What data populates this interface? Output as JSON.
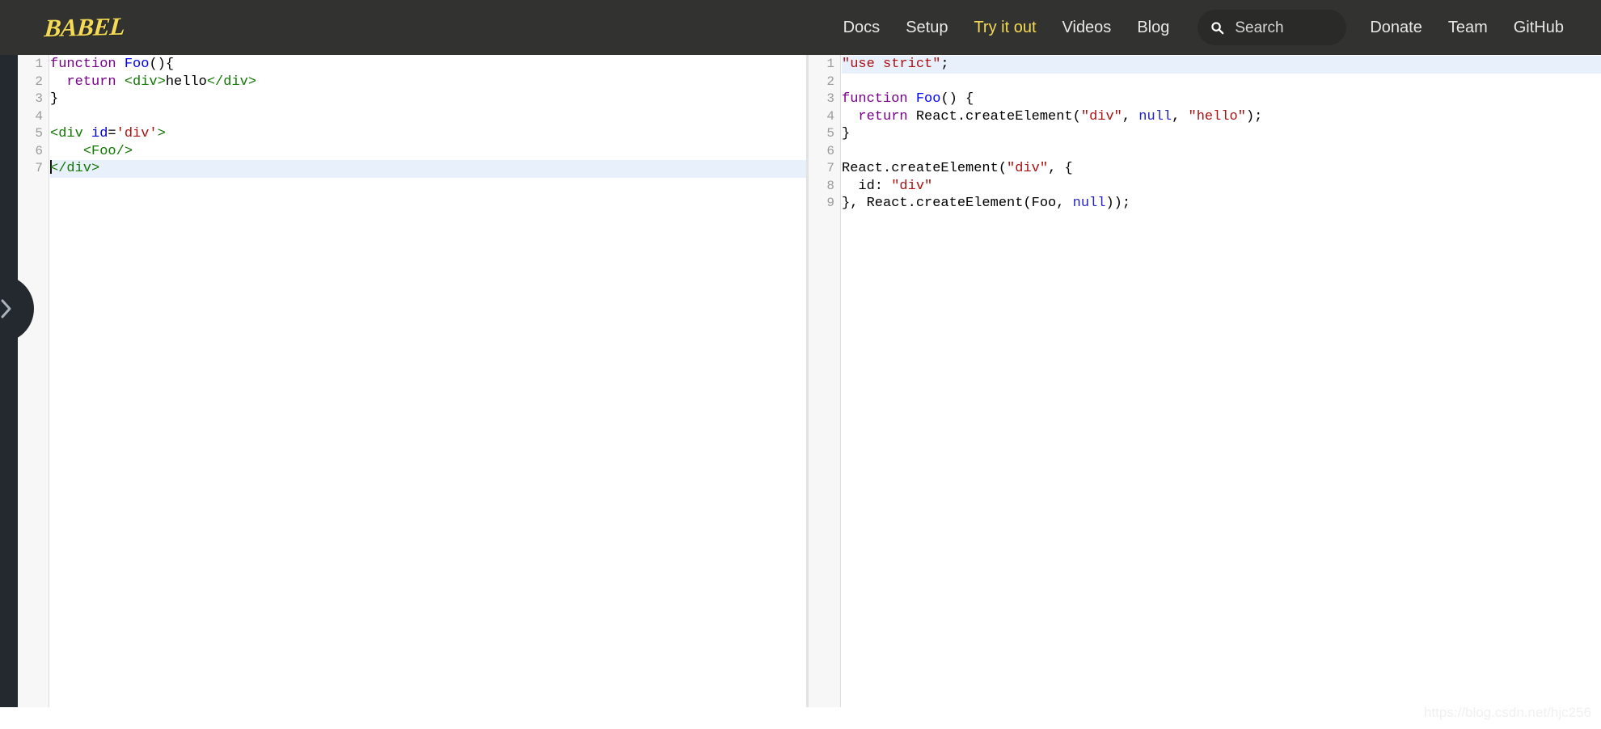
{
  "header": {
    "logo_text": "BABEL",
    "logo_color": "#f5da55",
    "background": "#323330",
    "nav_items": [
      {
        "label": "Docs",
        "active": false
      },
      {
        "label": "Setup",
        "active": false
      },
      {
        "label": "Try it out",
        "active": true
      },
      {
        "label": "Videos",
        "active": false
      },
      {
        "label": "Blog",
        "active": false
      }
    ],
    "search": {
      "placeholder": "Search",
      "icon": "search-icon"
    },
    "nav_items_right": [
      {
        "label": "Donate"
      },
      {
        "label": "Team"
      },
      {
        "label": "GitHub"
      }
    ]
  },
  "sidebar_toggle": {
    "icon": "chevron-right-icon",
    "background": "#24292f"
  },
  "editor": {
    "input": {
      "active_line": 7,
      "cursor_line": 7,
      "cursor_column": 1,
      "lines": [
        {
          "num": "1",
          "tokens": [
            {
              "t": "function",
              "c": "t-kw"
            },
            {
              "t": " ",
              "c": "t-plain"
            },
            {
              "t": "Foo",
              "c": "t-def"
            },
            {
              "t": "(){",
              "c": "t-plain"
            }
          ]
        },
        {
          "num": "2",
          "tokens": [
            {
              "t": "  ",
              "c": "t-plain"
            },
            {
              "t": "return",
              "c": "t-kw"
            },
            {
              "t": " ",
              "c": "t-plain"
            },
            {
              "t": "<div>",
              "c": "t-tag"
            },
            {
              "t": "hello",
              "c": "t-plain"
            },
            {
              "t": "</div>",
              "c": "t-tag"
            }
          ]
        },
        {
          "num": "3",
          "tokens": [
            {
              "t": "}",
              "c": "t-plain"
            }
          ]
        },
        {
          "num": "4",
          "tokens": [
            {
              "t": "",
              "c": "t-plain"
            }
          ]
        },
        {
          "num": "5",
          "tokens": [
            {
              "t": "<div ",
              "c": "t-tag"
            },
            {
              "t": "id",
              "c": "t-attr"
            },
            {
              "t": "=",
              "c": "t-plain"
            },
            {
              "t": "'div'",
              "c": "t-str"
            },
            {
              "t": ">",
              "c": "t-tag"
            }
          ]
        },
        {
          "num": "6",
          "tokens": [
            {
              "t": "    ",
              "c": "t-plain"
            },
            {
              "t": "<Foo/>",
              "c": "t-tag"
            }
          ]
        },
        {
          "num": "7",
          "tokens": [
            {
              "t": "</div>",
              "c": "t-tag"
            }
          ]
        }
      ]
    },
    "output": {
      "active_line": 1,
      "lines": [
        {
          "num": "1",
          "tokens": [
            {
              "t": "\"use strict\"",
              "c": "t-str"
            },
            {
              "t": ";",
              "c": "t-plain"
            }
          ]
        },
        {
          "num": "2",
          "tokens": [
            {
              "t": "",
              "c": "t-plain"
            }
          ]
        },
        {
          "num": "3",
          "tokens": [
            {
              "t": "function",
              "c": "t-kw"
            },
            {
              "t": " ",
              "c": "t-plain"
            },
            {
              "t": "Foo",
              "c": "t-def"
            },
            {
              "t": "() {",
              "c": "t-plain"
            }
          ]
        },
        {
          "num": "4",
          "tokens": [
            {
              "t": "  ",
              "c": "t-plain"
            },
            {
              "t": "return",
              "c": "t-kw"
            },
            {
              "t": " React.createElement(",
              "c": "t-plain"
            },
            {
              "t": "\"div\"",
              "c": "t-str"
            },
            {
              "t": ", ",
              "c": "t-plain"
            },
            {
              "t": "null",
              "c": "t-atom"
            },
            {
              "t": ", ",
              "c": "t-plain"
            },
            {
              "t": "\"hello\"",
              "c": "t-str"
            },
            {
              "t": ");",
              "c": "t-plain"
            }
          ]
        },
        {
          "num": "5",
          "tokens": [
            {
              "t": "}",
              "c": "t-plain"
            }
          ]
        },
        {
          "num": "6",
          "tokens": [
            {
              "t": "",
              "c": "t-plain"
            }
          ]
        },
        {
          "num": "7",
          "tokens": [
            {
              "t": "React.createElement(",
              "c": "t-plain"
            },
            {
              "t": "\"div\"",
              "c": "t-str"
            },
            {
              "t": ", {",
              "c": "t-plain"
            }
          ]
        },
        {
          "num": "8",
          "tokens": [
            {
              "t": "  id: ",
              "c": "t-plain"
            },
            {
              "t": "\"div\"",
              "c": "t-str"
            }
          ]
        },
        {
          "num": "9",
          "tokens": [
            {
              "t": "}, React.createElement(Foo, ",
              "c": "t-plain"
            },
            {
              "t": "null",
              "c": "t-atom"
            },
            {
              "t": "));",
              "c": "t-plain"
            }
          ]
        }
      ]
    }
  },
  "watermark": {
    "text": "https://blog.csdn.net/hjc256"
  }
}
